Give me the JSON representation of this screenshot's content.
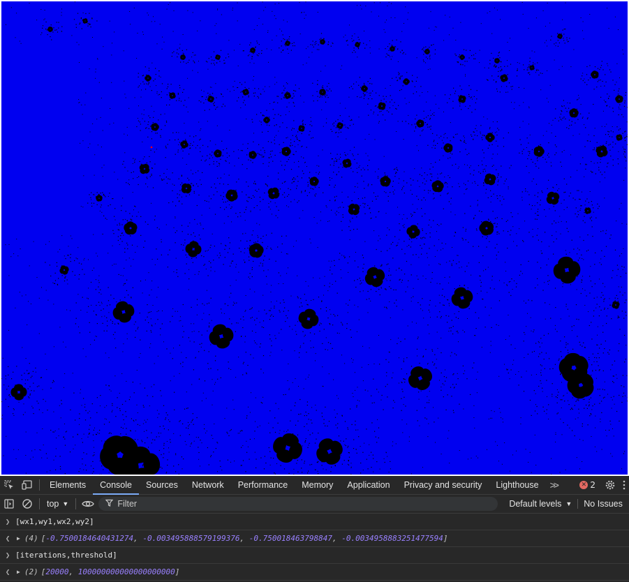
{
  "devtools": {
    "tabs": [
      "Elements",
      "Console",
      "Sources",
      "Network",
      "Performance",
      "Memory",
      "Application",
      "Privacy and security",
      "Lighthouse"
    ],
    "active_tab": "Console",
    "more_tabs_label": ">>",
    "error_count": "2",
    "toolbar": {
      "context": "top",
      "filter_placeholder": "Filter",
      "levels_label": "Default levels",
      "issues_label": "No Issues"
    },
    "console": {
      "entries": [
        {
          "type": "input",
          "text": "[wx1,wy1,wx2,wy2]"
        },
        {
          "type": "result",
          "count": "(4)",
          "open": "[",
          "values": [
            "-0.75001846404312​74",
            "-0.003495888579199376",
            "-0.750018463798847",
            "-0.0034958883251477594"
          ],
          "close": "]"
        },
        {
          "type": "input",
          "text": "[iterations,threshold]"
        },
        {
          "type": "result",
          "count": "(2)",
          "open": "[",
          "values": [
            "20000",
            "100000000000000000000"
          ],
          "close": "]"
        }
      ]
    }
  },
  "colors": {
    "fractal_background": "#0000f0",
    "fractal_set": "#000000",
    "marker": "#ff0000",
    "devtools_background": "#282828",
    "active_tab_underline": "#7cacf8",
    "console_number": "#9980ff"
  }
}
